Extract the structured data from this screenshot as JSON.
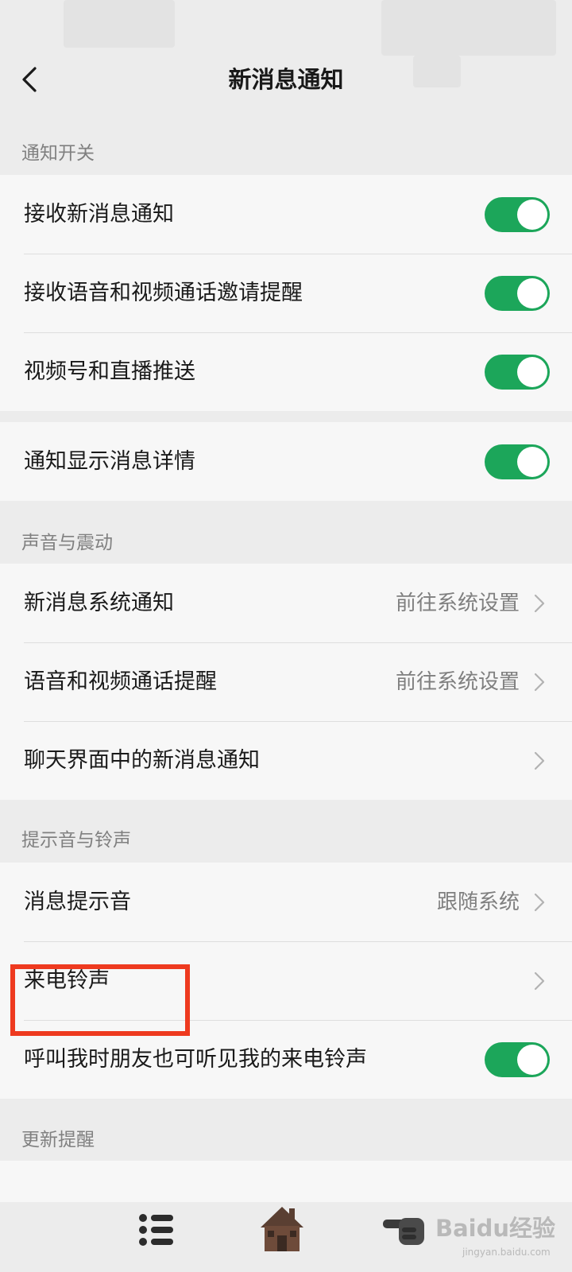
{
  "header": {
    "title": "新消息通知"
  },
  "sections": {
    "notify_switch": "通知开关",
    "sound_vibration": "声音与震动",
    "tones": "提示音与铃声",
    "update": "更新提醒"
  },
  "notify_group": {
    "receive_new": {
      "label": "接收新消息通知",
      "on": true
    },
    "voice_video_invite": {
      "label": "接收语音和视频通话邀请提醒",
      "on": true
    },
    "channels_live": {
      "label": "视频号和直播推送",
      "on": true
    }
  },
  "detail_group": {
    "show_detail": {
      "label": "通知显示消息详情",
      "on": true
    }
  },
  "sound_group": {
    "system_notify": {
      "label": "新消息系统通知",
      "value": "前往系统设置"
    },
    "call_reminder": {
      "label": "语音和视频通话提醒",
      "value": "前往系统设置"
    },
    "chat_notify": {
      "label": "聊天界面中的新消息通知"
    }
  },
  "tone_group": {
    "message_tone": {
      "label": "消息提示音",
      "value": "跟随系统"
    },
    "ringtone": {
      "label": "来电铃声"
    },
    "friends_hear": {
      "label": "呼叫我时朋友也可听见我的来电铃声",
      "on": true
    }
  },
  "watermark": {
    "logo": "Baidu经验",
    "sub": "jingyan.baidu.com"
  },
  "colors": {
    "toggle_on": "#1ca65a",
    "highlight": "#ee3a1f",
    "background": "#ececec",
    "cell": "#f7f7f7"
  },
  "icons": [
    "back-arrow-icon",
    "chevron-right-icon",
    "list-icon",
    "home-icon",
    "pointing-hand-icon"
  ]
}
